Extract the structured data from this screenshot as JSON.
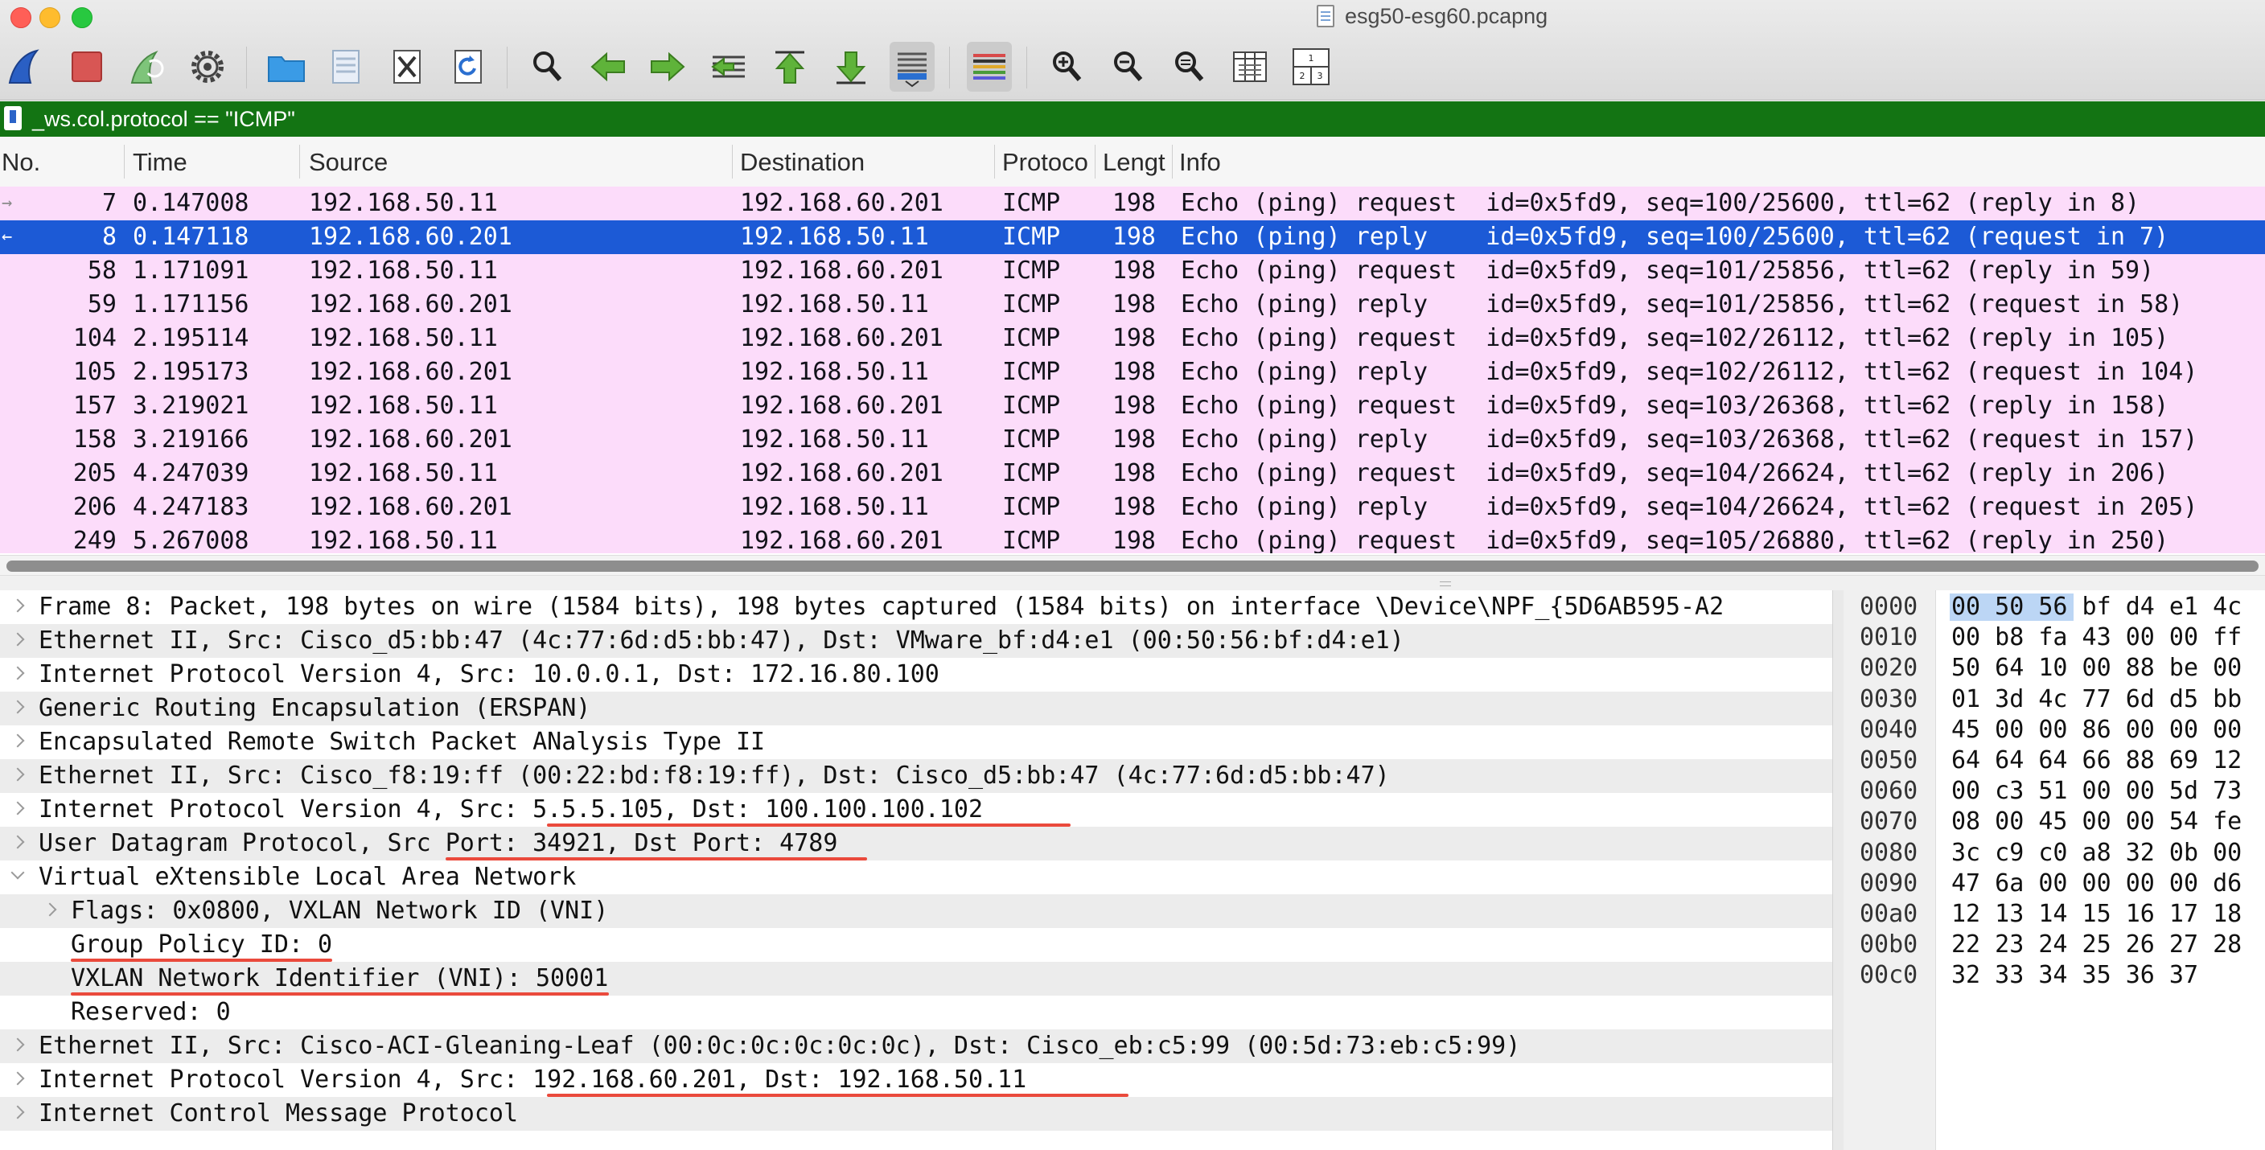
{
  "window": {
    "title": "esg50-esg60.pcapng"
  },
  "toolbar": {
    "buttons": [
      {
        "name": "start-capture-icon",
        "active": false
      },
      {
        "name": "stop-capture-icon",
        "active": false
      },
      {
        "name": "restart-capture-icon",
        "active": false
      },
      {
        "name": "capture-options-gear-icon",
        "active": false
      },
      {
        "name": "open-file-folder-icon",
        "active": false
      },
      {
        "name": "save-file-icon",
        "active": false
      },
      {
        "name": "close-file-icon",
        "active": false
      },
      {
        "name": "reload-file-icon",
        "active": false
      },
      {
        "name": "find-packet-magnifier-icon",
        "active": false
      },
      {
        "name": "go-back-arrow-icon",
        "active": false
      },
      {
        "name": "go-forward-arrow-icon",
        "active": false
      },
      {
        "name": "go-to-packet-icon",
        "active": false
      },
      {
        "name": "go-to-first-packet-icon",
        "active": false
      },
      {
        "name": "go-to-last-packet-icon",
        "active": false
      },
      {
        "name": "auto-scroll-icon",
        "active": true
      },
      {
        "name": "colorize-list-icon",
        "active": true
      },
      {
        "name": "zoom-in-icon",
        "active": false
      },
      {
        "name": "zoom-out-icon",
        "active": false
      },
      {
        "name": "normal-size-icon",
        "active": false
      },
      {
        "name": "resize-columns-icon",
        "active": false
      },
      {
        "name": "layout-panes-icon",
        "active": false
      }
    ],
    "layout_icon_digits": [
      "1",
      "2",
      "3"
    ]
  },
  "filter": {
    "expression": "_ws.col.protocol == \"ICMP\"",
    "background_color": "#137413"
  },
  "packet_list": {
    "columns": [
      "No.",
      "Time",
      "Source",
      "Destination",
      "Protoco",
      "Lengt",
      "Info"
    ],
    "rows": [
      {
        "mark": "→",
        "no": "7",
        "time": "0.147008",
        "source": "192.168.50.11",
        "destination": "192.168.60.201",
        "protocol": "ICMP",
        "length": "198",
        "info": "Echo (ping) request  id=0x5fd9, seq=100/25600, ttl=62 (reply in 8)",
        "selected": false
      },
      {
        "mark": "←",
        "no": "8",
        "time": "0.147118",
        "source": "192.168.60.201",
        "destination": "192.168.50.11",
        "protocol": "ICMP",
        "length": "198",
        "info": "Echo (ping) reply    id=0x5fd9, seq=100/25600, ttl=62 (request in 7)",
        "selected": true
      },
      {
        "mark": "",
        "no": "58",
        "time": "1.171091",
        "source": "192.168.50.11",
        "destination": "192.168.60.201",
        "protocol": "ICMP",
        "length": "198",
        "info": "Echo (ping) request  id=0x5fd9, seq=101/25856, ttl=62 (reply in 59)",
        "selected": false
      },
      {
        "mark": "",
        "no": "59",
        "time": "1.171156",
        "source": "192.168.60.201",
        "destination": "192.168.50.11",
        "protocol": "ICMP",
        "length": "198",
        "info": "Echo (ping) reply    id=0x5fd9, seq=101/25856, ttl=62 (request in 58)",
        "selected": false
      },
      {
        "mark": "",
        "no": "104",
        "time": "2.195114",
        "source": "192.168.50.11",
        "destination": "192.168.60.201",
        "protocol": "ICMP",
        "length": "198",
        "info": "Echo (ping) request  id=0x5fd9, seq=102/26112, ttl=62 (reply in 105)",
        "selected": false
      },
      {
        "mark": "",
        "no": "105",
        "time": "2.195173",
        "source": "192.168.60.201",
        "destination": "192.168.50.11",
        "protocol": "ICMP",
        "length": "198",
        "info": "Echo (ping) reply    id=0x5fd9, seq=102/26112, ttl=62 (request in 104)",
        "selected": false
      },
      {
        "mark": "",
        "no": "157",
        "time": "3.219021",
        "source": "192.168.50.11",
        "destination": "192.168.60.201",
        "protocol": "ICMP",
        "length": "198",
        "info": "Echo (ping) request  id=0x5fd9, seq=103/26368, ttl=62 (reply in 158)",
        "selected": false
      },
      {
        "mark": "",
        "no": "158",
        "time": "3.219166",
        "source": "192.168.60.201",
        "destination": "192.168.50.11",
        "protocol": "ICMP",
        "length": "198",
        "info": "Echo (ping) reply    id=0x5fd9, seq=103/26368, ttl=62 (request in 157)",
        "selected": false
      },
      {
        "mark": "",
        "no": "205",
        "time": "4.247039",
        "source": "192.168.50.11",
        "destination": "192.168.60.201",
        "protocol": "ICMP",
        "length": "198",
        "info": "Echo (ping) request  id=0x5fd9, seq=104/26624, ttl=62 (reply in 206)",
        "selected": false
      },
      {
        "mark": "",
        "no": "206",
        "time": "4.247183",
        "source": "192.168.60.201",
        "destination": "192.168.50.11",
        "protocol": "ICMP",
        "length": "198",
        "info": "Echo (ping) reply    id=0x5fd9, seq=104/26624, ttl=62 (request in 205)",
        "selected": false
      },
      {
        "mark": "",
        "no": "249",
        "time": "5.267008",
        "source": "192.168.50.11",
        "destination": "192.168.60.201",
        "protocol": "ICMP",
        "length": "198",
        "info": "Echo (ping) request  id=0x5fd9, seq=105/26880, ttl=62 (reply in 250)",
        "selected": false
      }
    ],
    "row_color": "#fcdcfa",
    "selected_color": "#1c5ad6"
  },
  "details": {
    "rows": [
      {
        "text": "Frame 8: Packet, 198 bytes on wire (1584 bits), 198 bytes captured (1584 bits) on interface \\Device\\NPF_{5D6AB595-A2",
        "indent": 0,
        "chevron": "closed",
        "shaded": false
      },
      {
        "text": "Ethernet II, Src: Cisco_d5:bb:47 (4c:77:6d:d5:bb:47), Dst: VMware_bf:d4:e1 (00:50:56:bf:d4:e1)",
        "indent": 0,
        "chevron": "closed",
        "shaded": true
      },
      {
        "text": "Internet Protocol Version 4, Src: 10.0.0.1, Dst: 172.16.80.100",
        "indent": 0,
        "chevron": "closed",
        "shaded": false
      },
      {
        "text": "Generic Routing Encapsulation (ERSPAN)",
        "indent": 0,
        "chevron": "closed",
        "shaded": true
      },
      {
        "text": "Encapsulated Remote Switch Packet ANalysis Type II",
        "indent": 0,
        "chevron": "closed",
        "shaded": false
      },
      {
        "text": "Ethernet II, Src: Cisco_f8:19:ff (00:22:bd:f8:19:ff), Dst: Cisco_d5:bb:47 (4c:77:6d:d5:bb:47)",
        "indent": 0,
        "chevron": "closed",
        "shaded": true
      },
      {
        "text": "Internet Protocol Version 4, Src: 5.5.5.105, Dst: 100.100.100.102",
        "indent": 0,
        "chevron": "closed",
        "shaded": false,
        "underline": {
          "from": 35,
          "to": 71
        }
      },
      {
        "text": "User Datagram Protocol, Src Port: 34921, Dst Port: 4789",
        "indent": 0,
        "chevron": "closed",
        "shaded": true,
        "underline": {
          "from": 28,
          "to": 57
        }
      },
      {
        "text": "Virtual eXtensible Local Area Network",
        "indent": 0,
        "chevron": "open",
        "shaded": false
      },
      {
        "text": "Flags: 0x0800, VXLAN Network ID (VNI)",
        "indent": 1,
        "chevron": "closed",
        "shaded": true
      },
      {
        "text": "Group Policy ID: 0",
        "indent": 1,
        "chevron": "none",
        "shaded": false,
        "underline": {
          "from": 0,
          "to": 18
        }
      },
      {
        "text": "VXLAN Network Identifier (VNI): 50001",
        "indent": 1,
        "chevron": "none",
        "shaded": true,
        "underline": {
          "from": 0,
          "to": 37
        }
      },
      {
        "text": "Reserved: 0",
        "indent": 1,
        "chevron": "none",
        "shaded": false
      },
      {
        "text": "Ethernet II, Src: Cisco-ACI-Gleaning-Leaf (00:0c:0c:0c:0c:0c), Dst: Cisco_eb:c5:99 (00:5d:73:eb:c5:99)",
        "indent": 0,
        "chevron": "closed",
        "shaded": true
      },
      {
        "text": "Internet Protocol Version 4, Src: 192.168.60.201, Dst: 192.168.50.11",
        "indent": 0,
        "chevron": "closed",
        "shaded": false,
        "underline": {
          "from": 35,
          "to": 75
        }
      },
      {
        "text": "Internet Control Message Protocol",
        "indent": 0,
        "chevron": "closed",
        "shaded": true
      }
    ],
    "annotation_color": "#ea4a3c"
  },
  "bytes": {
    "rows": [
      {
        "offset": "0000",
        "hex": "00 50 56 bf d4 e1 4c"
      },
      {
        "offset": "0010",
        "hex": "00 b8 fa 43 00 00 ff"
      },
      {
        "offset": "0020",
        "hex": "50 64 10 00 88 be 00"
      },
      {
        "offset": "0030",
        "hex": "01 3d 4c 77 6d d5 bb"
      },
      {
        "offset": "0040",
        "hex": "45 00 00 86 00 00 00"
      },
      {
        "offset": "0050",
        "hex": "64 64 64 66 88 69 12"
      },
      {
        "offset": "0060",
        "hex": "00 c3 51 00 00 5d 73"
      },
      {
        "offset": "0070",
        "hex": "08 00 45 00 00 54 fe"
      },
      {
        "offset": "0080",
        "hex": "3c c9 c0 a8 32 0b 00"
      },
      {
        "offset": "0090",
        "hex": "47 6a 00 00 00 00 d6"
      },
      {
        "offset": "00a0",
        "hex": "12 13 14 15 16 17 18"
      },
      {
        "offset": "00b0",
        "hex": "22 23 24 25 26 27 28"
      },
      {
        "offset": "00c0",
        "hex": "32 33 34 35 36 37"
      }
    ],
    "highlighted": "00 50 56",
    "highlight_color": "#bcd6f5"
  }
}
